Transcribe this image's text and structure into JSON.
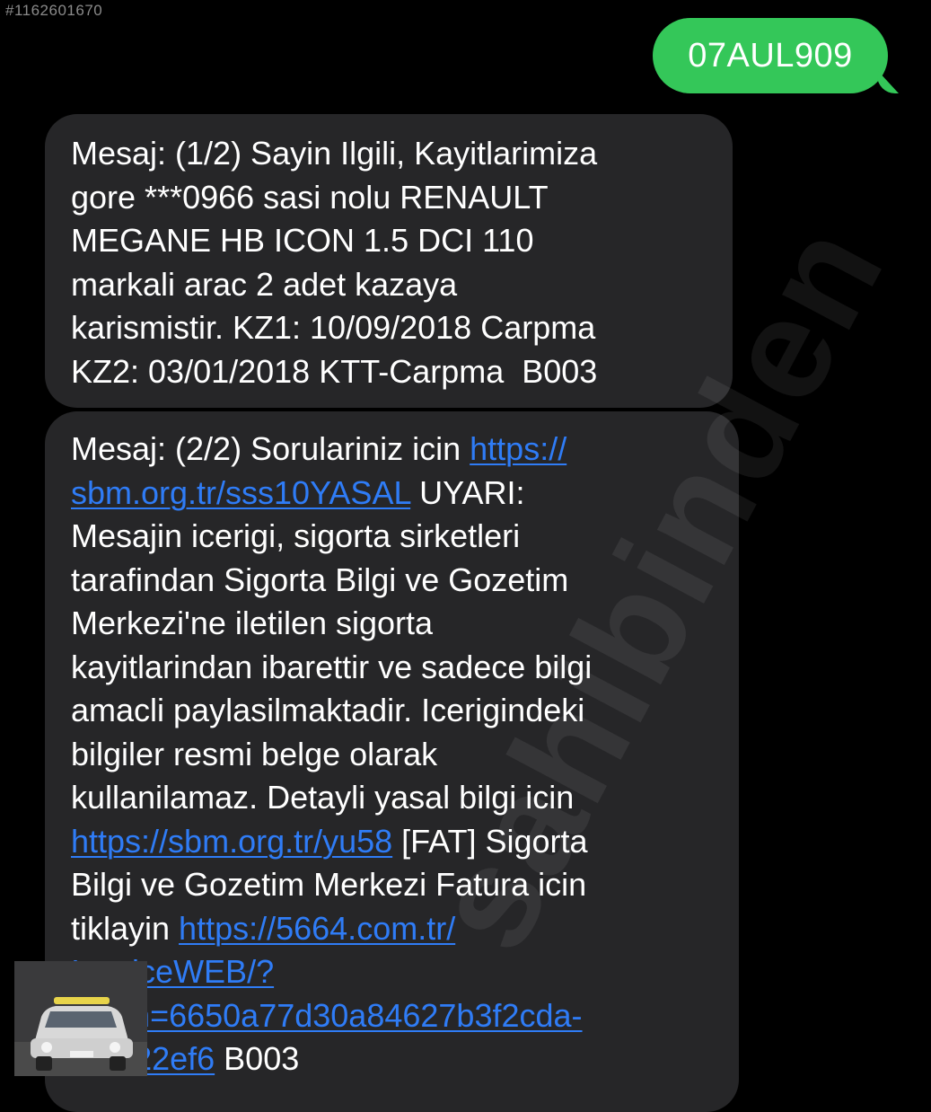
{
  "listing_id": "#1162601670",
  "sent_message": {
    "text": "07AUL909"
  },
  "received_messages": [
    {
      "lines": [
        [
          {
            "t": "Mesaj: (1/2) Sayin Ilgili, Kayitlarimiza"
          }
        ],
        [
          {
            "t": "gore ***0966 sasi nolu RENAULT"
          }
        ],
        [
          {
            "t": "MEGANE HB ICON 1.5 DCI 110"
          }
        ],
        [
          {
            "t": "markali arac 2 adet kazaya"
          }
        ],
        [
          {
            "t": "karismistir. KZ1: 10/09/2018 Carpma"
          }
        ],
        [
          {
            "t": "KZ2: 03/01/2018 KTT-Carpma  B003"
          }
        ]
      ]
    },
    {
      "lines": [
        [
          {
            "t": "Mesaj: (2/2) Sorulariniz icin "
          },
          {
            "t": "https://",
            "link": true
          }
        ],
        [
          {
            "t": "sbm.org.tr/sss10YASAL",
            "link": true
          },
          {
            "t": " UYARI:"
          }
        ],
        [
          {
            "t": "Mesajin icerigi, sigorta sirketleri"
          }
        ],
        [
          {
            "t": "tarafindan Sigorta Bilgi ve Gozetim"
          }
        ],
        [
          {
            "t": "Merkezi'ne iletilen sigorta"
          }
        ],
        [
          {
            "t": "kayitlarindan ibarettir ve sadece bilgi"
          }
        ],
        [
          {
            "t": "amacli paylasilmaktadir. Icerigindeki"
          }
        ],
        [
          {
            "t": "bilgiler resmi belge olarak"
          }
        ],
        [
          {
            "t": "kullanilamaz. Detayli yasal bilgi icin"
          }
        ],
        [
          {
            "t": "https://sbm.org.tr/yu58",
            "link": true
          },
          {
            "t": " [FAT] Sigorta"
          }
        ],
        [
          {
            "t": "Bilgi ve Gozetim Merkezi Fatura icin"
          }
        ],
        [
          {
            "t": "tiklayin "
          },
          {
            "t": "https://5664.com.tr/",
            "link": true
          }
        ],
        [
          {
            "t": "InvoiceWEB/?",
            "link": true
          }
        ],
        [
          {
            "t": "token=6650a77d30a84627b3f2cda-",
            "link": true
          }
        ],
        [
          {
            "t": "f00722ef6",
            "link": true
          },
          {
            "t": " B003"
          }
        ]
      ]
    }
  ],
  "watermark": "sahibinden",
  "colors": {
    "background": "#000000",
    "sent_bubble": "#34c759",
    "received_bubble": "#262628",
    "link": "#2f7cf6",
    "text": "#ffffff"
  }
}
